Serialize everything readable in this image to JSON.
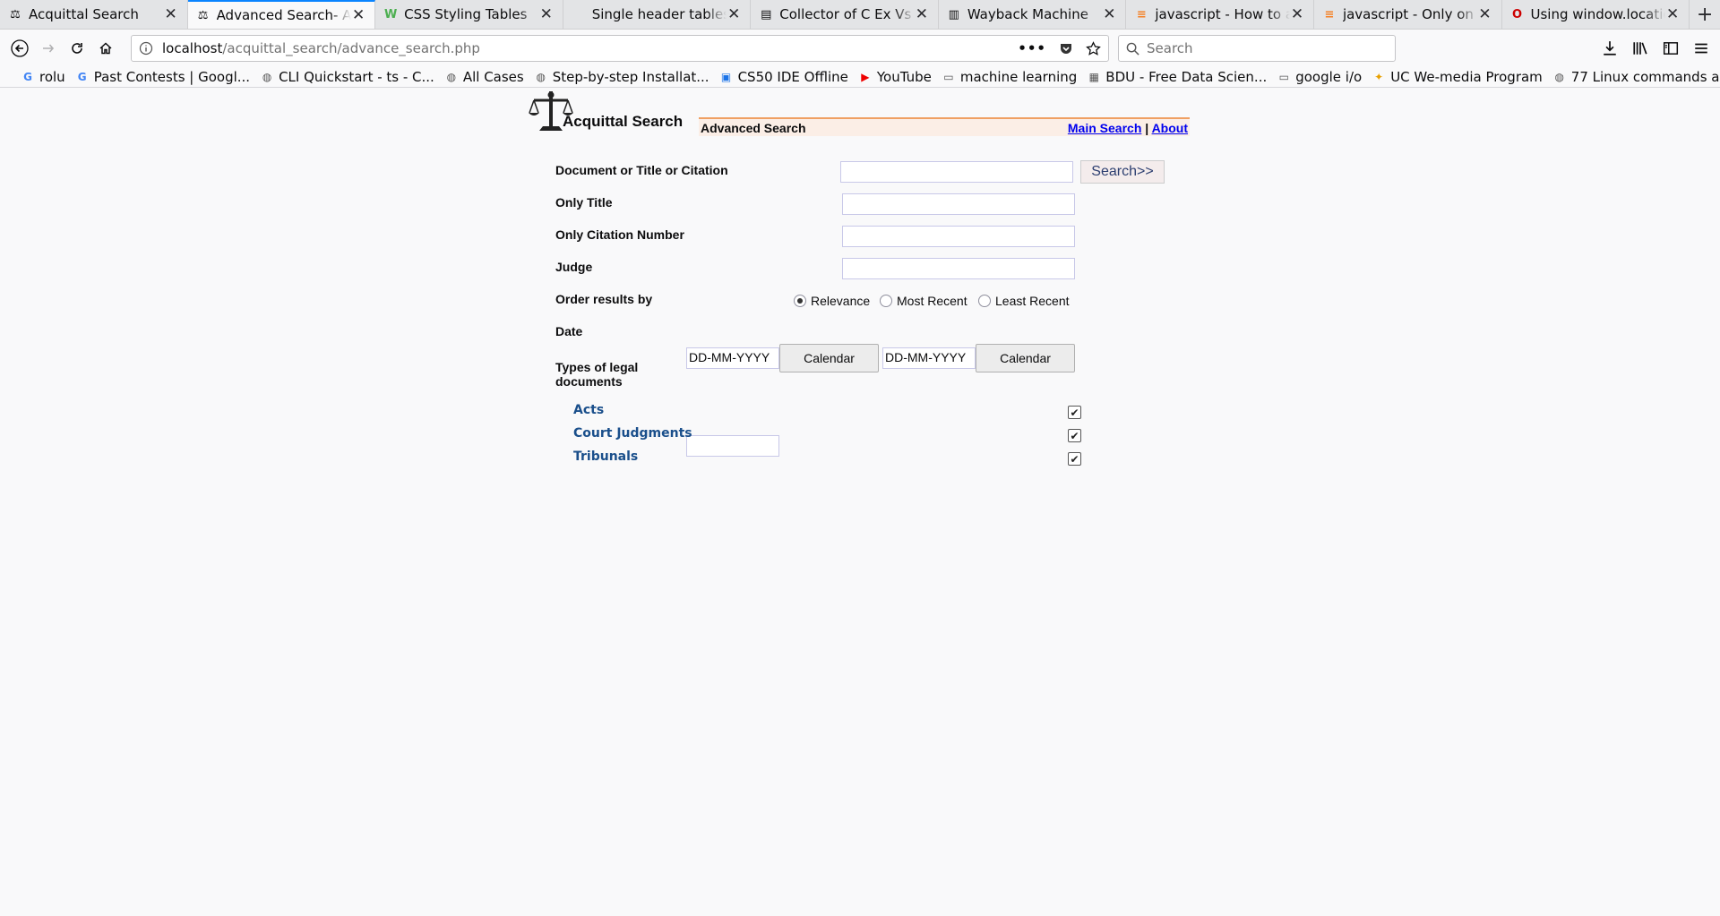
{
  "browser": {
    "tabs": [
      {
        "title": "Acquittal Search",
        "icon": "scales-icon",
        "active": false
      },
      {
        "title": "Advanced Search- Acq",
        "icon": "scales-icon",
        "active": true
      },
      {
        "title": "CSS Styling Tables",
        "icon": "w3-icon",
        "active": false
      },
      {
        "title": "Single header tables - Fo",
        "icon": "blank-icon",
        "active": false
      },
      {
        "title": "Collector of C Ex Vs Su",
        "icon": "document-icon",
        "active": false
      },
      {
        "title": "Wayback Machine",
        "icon": "archive-icon",
        "active": false
      },
      {
        "title": "javascript - How to ad",
        "icon": "stackoverflow-icon",
        "active": false
      },
      {
        "title": "javascript - Only on Fi",
        "icon": "stackoverflow-icon",
        "active": false
      },
      {
        "title": "Using window.location",
        "icon": "opera-icon",
        "active": false
      }
    ],
    "url_host": "localhost",
    "url_path": "/acquittal_search/advance_search.php",
    "search_placeholder": "Search",
    "bookmarks": [
      {
        "label": "rolu",
        "icon": "google-icon"
      },
      {
        "label": "Past Contests | Googl...",
        "icon": "google-icon"
      },
      {
        "label": "CLI Quickstart - ts - C...",
        "icon": "globe-icon"
      },
      {
        "label": "All Cases",
        "icon": "globe-icon"
      },
      {
        "label": "Step-by-step Installat...",
        "icon": "globe-icon"
      },
      {
        "label": "CS50 IDE Offline",
        "icon": "cs50-icon"
      },
      {
        "label": "YouTube",
        "icon": "youtube-icon"
      },
      {
        "label": "machine learning",
        "icon": "folder-icon"
      },
      {
        "label": "BDU - Free Data Scien...",
        "icon": "bdu-icon"
      },
      {
        "label": "google i/o",
        "icon": "folder-icon"
      },
      {
        "label": "UC We-media Program",
        "icon": "uc-icon"
      },
      {
        "label": "77 Linux commands a...",
        "icon": "globe-icon"
      }
    ]
  },
  "site": {
    "brand": "Acquittal Search",
    "section_label": "Advanced Search",
    "links": {
      "main": "Main Search",
      "sep": "|",
      "about": "About"
    }
  },
  "form": {
    "doc_label": "Document or Title or Citation",
    "search_button": "Search>>",
    "title_label": "Only Title",
    "citation_label": "Only Citation Number",
    "judge_label": "Judge",
    "order_label": "Order results by",
    "order_options": [
      "Relevance",
      "Most Recent",
      "Least Recent"
    ],
    "order_selected": "Relevance",
    "date_label": "Date",
    "date_from": "DD-MM-YYYY",
    "date_to": "DD-MM-YYYY",
    "calendar_label": "Calendar",
    "types_label": "Types of legal documents",
    "doc_types": [
      {
        "label": "Acts",
        "checked": true
      },
      {
        "label": "Court Judgments",
        "checked": true
      },
      {
        "label": "Tribunals",
        "checked": true
      }
    ]
  }
}
